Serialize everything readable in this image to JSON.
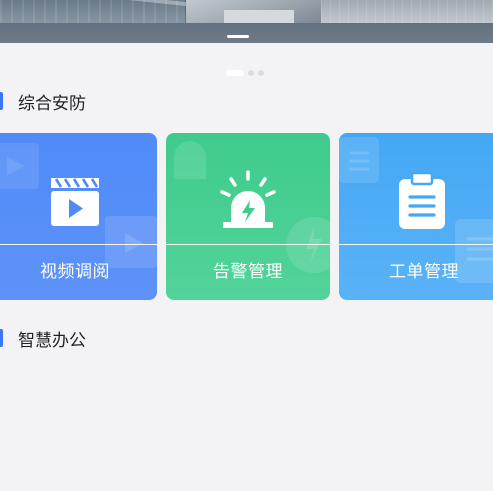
{
  "banner": {
    "image": "aerial-parking-lot-photo"
  },
  "carousel": {
    "count": 3,
    "active_index": 0
  },
  "sections": [
    {
      "title": "综合安防"
    },
    {
      "title": "智慧办公"
    }
  ],
  "cards": [
    {
      "label": "视频调阅",
      "icon": "video-clapper-icon",
      "color": "#4f8bf8"
    },
    {
      "label": "告警管理",
      "icon": "alarm-siren-icon",
      "color": "#3fcb8c"
    },
    {
      "label": "工单管理",
      "icon": "clipboard-icon",
      "color": "#44a8f5"
    }
  ]
}
